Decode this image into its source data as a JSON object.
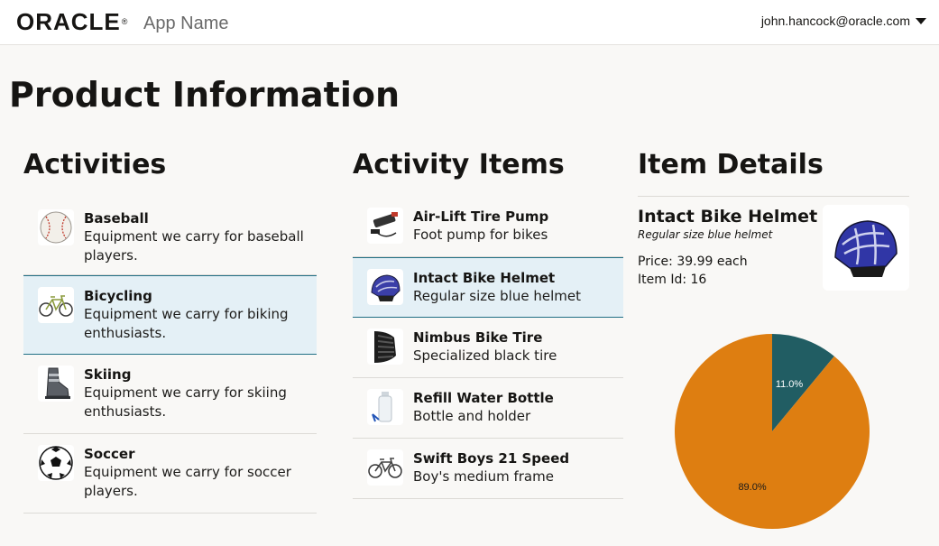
{
  "header": {
    "logo_text": "ORACLE",
    "logo_mark": "®",
    "app_name": "App Name",
    "user_email": "john.hancock@oracle.com"
  },
  "page_title": "Product Information",
  "activities": {
    "title": "Activities",
    "items": [
      {
        "name": "Baseball",
        "desc": "Equipment we carry for baseball players.",
        "icon": "baseball-icon"
      },
      {
        "name": "Bicycling",
        "desc": "Equipment we carry for biking enthusiasts.",
        "icon": "bicycle-icon",
        "selected": true
      },
      {
        "name": "Skiing",
        "desc": "Equipment we carry for skiing enthusiasts.",
        "icon": "ski-boot-icon"
      },
      {
        "name": "Soccer",
        "desc": "Equipment we carry for soccer players.",
        "icon": "soccer-ball-icon"
      }
    ]
  },
  "activity_items": {
    "title": "Activity Items",
    "items": [
      {
        "name": "Air-Lift Tire Pump",
        "desc": "Foot pump for bikes",
        "icon": "tire-pump-icon"
      },
      {
        "name": "Intact Bike Helmet",
        "desc": "Regular size blue helmet",
        "icon": "bike-helmet-icon",
        "selected": true
      },
      {
        "name": "Nimbus Bike Tire",
        "desc": "Specialized black tire",
        "icon": "bike-tire-icon"
      },
      {
        "name": "Refill Water Bottle",
        "desc": "Bottle and holder",
        "icon": "water-bottle-icon"
      },
      {
        "name": "Swift Boys 21 Speed",
        "desc": "Boy's medium frame",
        "icon": "bicycle-icon"
      }
    ]
  },
  "item_details": {
    "title": "Item Details",
    "name": "Intact Bike Helmet",
    "desc": "Regular size blue helmet",
    "price": "Price: 39.99 each",
    "item_id": "Item Id: 16",
    "image_icon": "bike-helmet-icon"
  },
  "chart_data": {
    "type": "pie",
    "title": "",
    "slices": [
      {
        "label": "11.0%",
        "value": 11.0,
        "color": "#215d63"
      },
      {
        "label": "89.0%",
        "value": 89.0,
        "color": "#de7e11"
      }
    ]
  },
  "colors": {
    "selected_bg": "#e4f0f6",
    "selected_border": "#227085",
    "page_bg": "#f9f8f6"
  }
}
